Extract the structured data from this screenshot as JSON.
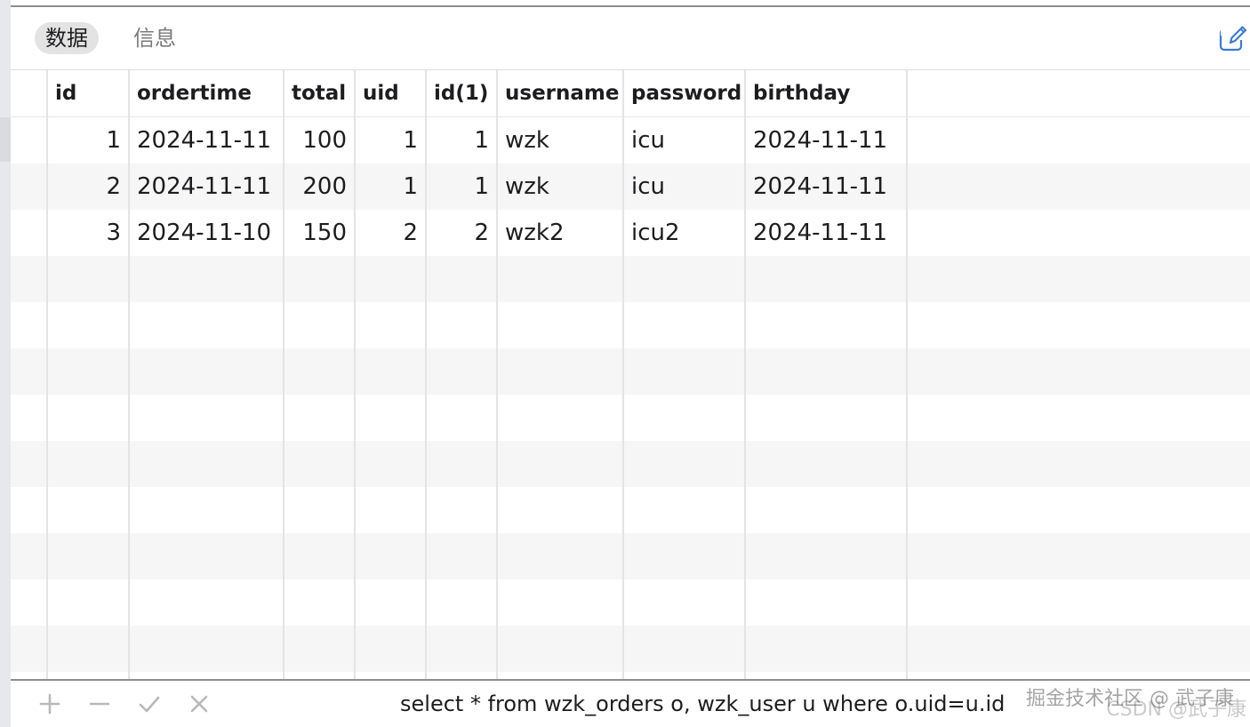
{
  "tabs": [
    {
      "label": "数据",
      "active": true
    },
    {
      "label": "信息",
      "active": false
    }
  ],
  "grid": {
    "columns": [
      "id",
      "ordertime",
      "total",
      "uid",
      "id(1)",
      "username",
      "password",
      "birthday"
    ],
    "rows": [
      [
        "1",
        "2024-11-11",
        "100",
        "1",
        "1",
        "wzk",
        "icu",
        "2024-11-11"
      ],
      [
        "2",
        "2024-11-11",
        "200",
        "1",
        "1",
        "wzk",
        "icu",
        "2024-11-11"
      ],
      [
        "3",
        "2024-11-10",
        "150",
        "2",
        "2",
        "wzk2",
        "icu2",
        "2024-11-11"
      ]
    ]
  },
  "toolbar": {
    "add_icon": "plus-icon",
    "remove_icon": "minus-icon",
    "apply_icon": "check-icon",
    "discard_icon": "x-icon",
    "edit_icon": "pencil-square-icon"
  },
  "query": {
    "sql": "select * from wzk_orders o, wzk_user u where o.uid=u.id"
  },
  "watermark": {
    "primary": "掘金技术社区 @ 武子康",
    "secondary": "CSDN @武子康"
  },
  "colors": {
    "accent": "#3a7bd5",
    "tab_active_bg": "#e3e3e3",
    "row_stripe": "#f6f6f6"
  }
}
